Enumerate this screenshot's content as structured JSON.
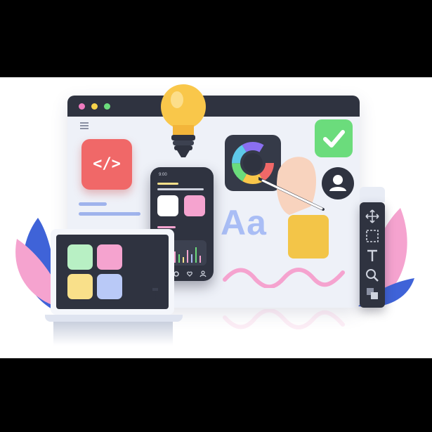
{
  "code_tile": {
    "label": "</>"
  },
  "typography_sample": {
    "label": "Aa"
  },
  "phone": {
    "time": "9:00"
  },
  "colors": {
    "dark": "#2f3340",
    "red": "#f06868",
    "green": "#6bdc7c",
    "pink": "#f5a3cf",
    "blue": "#a9bdf5",
    "yellow": "#f9e08a",
    "mint": "#b8f0c4",
    "window_bg": "#eef1f8"
  },
  "icons": [
    "code-icon",
    "lightbulb-icon",
    "color-wheel-icon",
    "checkmark-icon",
    "user-icon",
    "move-tool-icon",
    "marquee-tool-icon",
    "text-tool-icon",
    "zoom-tool-icon",
    "layers-tool-icon",
    "home-icon",
    "search-icon",
    "heart-icon",
    "profile-icon",
    "hand-with-stylus-icon",
    "pen-tool-icon"
  ]
}
